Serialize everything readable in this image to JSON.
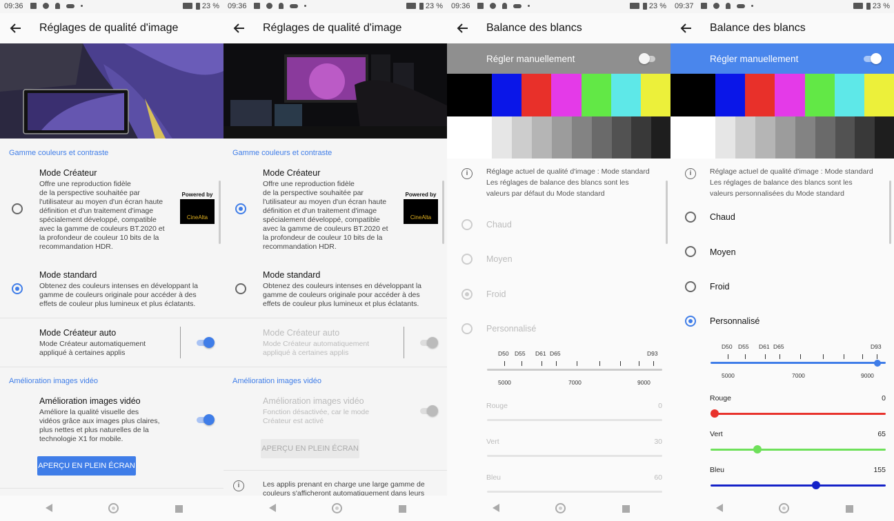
{
  "status": [
    {
      "time": "09:36",
      "battery": "23 %"
    },
    {
      "time": "09:36",
      "battery": "23 %"
    },
    {
      "time": "09:36",
      "battery": "23 %"
    },
    {
      "time": "09:37",
      "battery": "23 %"
    }
  ],
  "screens": {
    "p1": {
      "title": "Réglages de qualité d'image",
      "section1": "Gamme couleurs et contraste",
      "creator_title": "Mode Créateur",
      "creator_desc": "Offre une reproduction fidèle\nde la perspective souhaitée par\nl'utilisateur au moyen d'un écran haute\ndéfinition et d'un traitement d'image\nspécialement développé, compatible\navec la gamme de couleurs BT.2020 et\nla profondeur de couleur 10 bits de la\nrecommandation HDR.",
      "powered": "Powered by",
      "cinealta": "CineAlta",
      "standard_title": "Mode standard",
      "standard_desc": "Obtenez des couleurs intenses en développant la\ngamme de couleurs originale pour accéder à des\neffets de couleur plus lumineux et plus éclatants.",
      "auto_title": "Mode Créateur auto",
      "auto_desc": "Mode Créateur automatiquement\nappliqué à certaines applis",
      "section2": "Amélioration images vidéo",
      "video_title": "Amélioration images vidéo",
      "video_desc": "Améliore la qualité visuelle des\nvidéos grâce aux images plus claires,\nplus nettes et plus naturelles de la\ntechnologie X1 for mobile.",
      "preview": "APERÇU EN PLEIN ÉCRAN"
    },
    "p2": {
      "title": "Réglages de qualité d'image",
      "section1": "Gamme couleurs et contraste",
      "creator_title": "Mode Créateur",
      "creator_desc": "Offre une reproduction fidèle\nde la perspective souhaitée par\nl'utilisateur au moyen d'un écran haute\ndéfinition et d'un traitement d'image\nspécialement développé, compatible\navec la gamme de couleurs BT.2020 et\nla profondeur de couleur 10 bits de la\nrecommandation HDR.",
      "powered": "Powered by",
      "cinealta": "CineAlta",
      "standard_title": "Mode standard",
      "standard_desc": "Obtenez des couleurs intenses en développant la\ngamme de couleurs originale pour accéder à des\neffets de couleur plus lumineux et plus éclatants.",
      "auto_title": "Mode Créateur auto",
      "auto_desc": "Mode Créateur automatiquement\nappliqué à certaines applis",
      "section2": "Amélioration images vidéo",
      "video_title": "Amélioration images vidéo",
      "video_desc": "Fonction désactivée, car le mode\nCréateur est activé",
      "preview": "APERÇU EN PLEIN ÉCRAN",
      "info": "Les applis prenant en charge une large gamme de\ncouleurs s'afficheront automatiquement dans leurs"
    },
    "p3": {
      "title": "Balance des blancs",
      "manual": "Régler manuellement",
      "info": "Réglage actuel de qualité d'image : Mode standard\nLes réglages de balance des blancs sont les\nvaleurs par défaut du Mode standard",
      "options": [
        "Chaud",
        "Moyen",
        "Froid",
        "Personnalisé"
      ],
      "scale_labels": [
        "D50",
        "D55",
        "D61",
        "D65",
        "D93"
      ],
      "scale_nums": [
        "5000",
        "7000",
        "9000"
      ],
      "rouge": "Rouge",
      "rouge_val": "0",
      "vert": "Vert",
      "vert_val": "30",
      "bleu": "Bleu",
      "bleu_val": "60"
    },
    "p4": {
      "title": "Balance des blancs",
      "manual": "Régler manuellement",
      "info": "Réglage actuel de qualité d'image : Mode standard\nLes réglages de balance des blancs sont les\nvaleurs personnalisées du Mode standard",
      "options": [
        "Chaud",
        "Moyen",
        "Froid",
        "Personnalisé"
      ],
      "scale_labels": [
        "D50",
        "D55",
        "D61",
        "D65",
        "D93"
      ],
      "scale_nums": [
        "5000",
        "7000",
        "9000"
      ],
      "rouge": "Rouge",
      "rouge_val": "0",
      "vert": "Vert",
      "vert_val": "65",
      "bleu": "Bleu",
      "bleu_val": "155"
    }
  },
  "colors": {
    "accent": "#3f7de8",
    "red": "#e8322c",
    "green": "#6ee05a",
    "blue": "#1422c8"
  },
  "slider_max": 255
}
